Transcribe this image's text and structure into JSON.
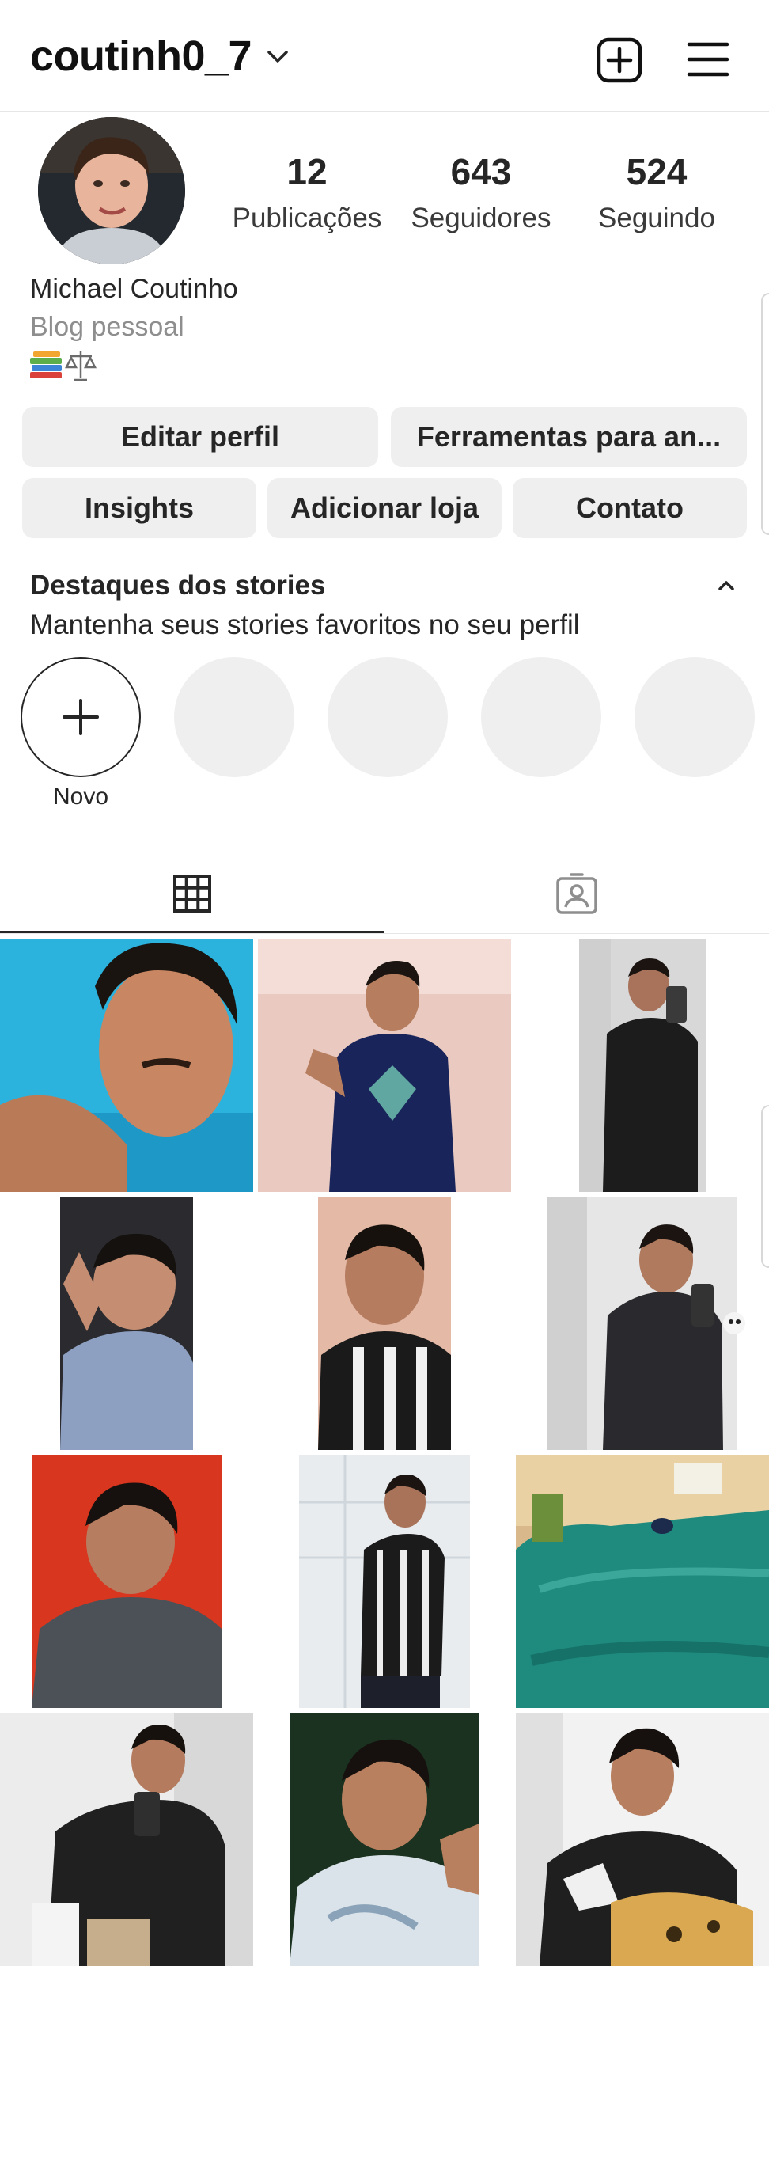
{
  "header": {
    "username": "coutinh0_7",
    "icons": [
      "chevron-down-icon",
      "new-post-icon",
      "menu-icon"
    ]
  },
  "profile": {
    "stats": [
      {
        "value": "12",
        "label": "Publicações"
      },
      {
        "value": "643",
        "label": "Seguidores"
      },
      {
        "value": "524",
        "label": "Seguindo"
      }
    ],
    "full_name": "Michael Coutinho",
    "category": "Blog pessoal",
    "bio_emoji": "📚⚖️"
  },
  "actions": {
    "edit_profile": "Editar perfil",
    "tools": "Ferramentas para an...",
    "insights": "Insights",
    "add_shop": "Adicionar loja",
    "contact": "Contato"
  },
  "highlights": {
    "title": "Destaques dos stories",
    "subtitle": "Mantenha seus stories favoritos no seu perfil",
    "new_label": "Novo",
    "placeholder_count": 4
  },
  "tabs": {
    "active": "grid",
    "items": [
      "grid-icon",
      "tagged-icon"
    ]
  },
  "colors": {
    "text": "#262626",
    "secondary": "#8e8e8e",
    "button_bg": "#efefef",
    "divider": "#e6e6e6"
  }
}
